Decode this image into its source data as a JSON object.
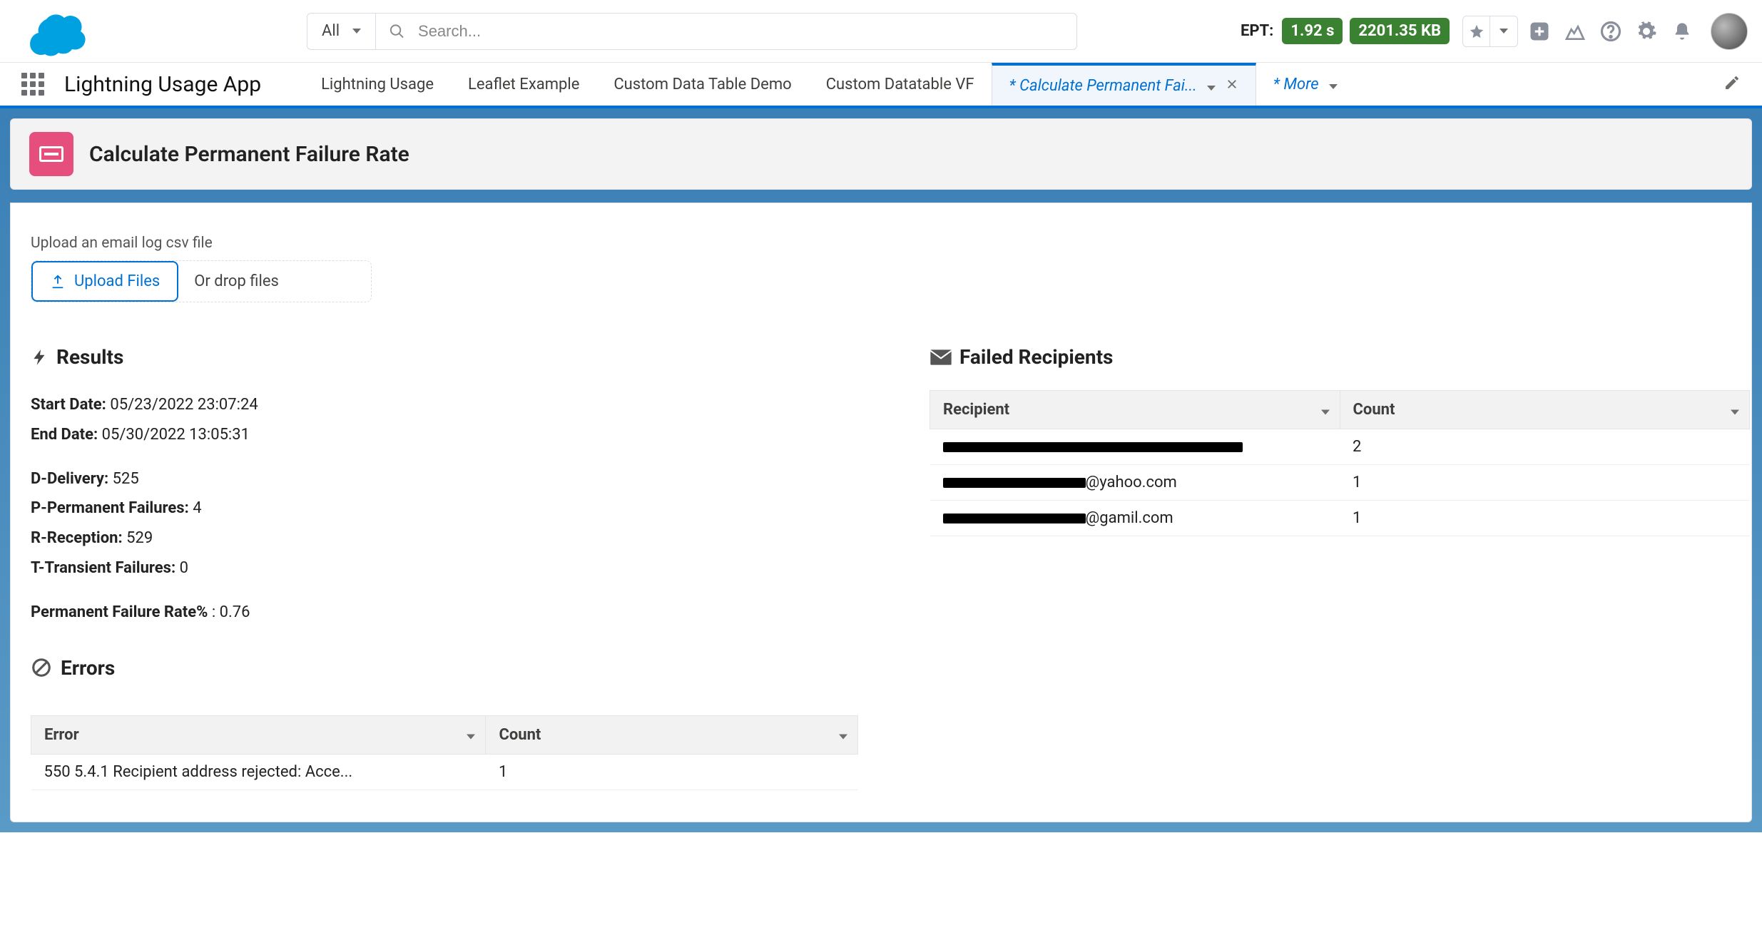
{
  "header": {
    "search_object": "All",
    "search_placeholder": "Search...",
    "ept_label": "EPT:",
    "ept_time": "1.92 s",
    "ept_size": "2201.35 KB"
  },
  "nav": {
    "app_name": "Lightning Usage App",
    "tabs": [
      {
        "label": "Lightning Usage"
      },
      {
        "label": "Leaflet Example"
      },
      {
        "label": "Custom Data Table Demo"
      },
      {
        "label": "Custom Datatable VF"
      }
    ],
    "active_tab": "* Calculate Permanent Fai...",
    "more_label": "* More"
  },
  "page": {
    "title": "Calculate Permanent Failure Rate"
  },
  "upload": {
    "label": "Upload an email log csv file",
    "button": "Upload Files",
    "drop": "Or drop files"
  },
  "results": {
    "heading": "Results",
    "start_date_label": "Start Date:",
    "start_date_value": "05/23/2022 23:07:24",
    "end_date_label": "End Date:",
    "end_date_value": "05/30/2022 13:05:31",
    "d_label": "D-Delivery:",
    "d_value": "525",
    "p_label": "P-Permanent Failures:",
    "p_value": "4",
    "r_label": "R-Reception:",
    "r_value": "529",
    "t_label": "T-Transient Failures:",
    "t_value": "0",
    "rate_label": "Permanent Failure Rate%",
    "rate_sep": " : ",
    "rate_value": "0.76"
  },
  "errors": {
    "heading": "Errors",
    "columns": {
      "error": "Error",
      "count": "Count"
    },
    "rows": [
      {
        "error": "550 5.4.1 Recipient address rejected: Acce...",
        "count": "1"
      }
    ]
  },
  "recipients": {
    "heading": "Failed Recipients",
    "columns": {
      "recipient": "Recipient",
      "count": "Count"
    },
    "rows": [
      {
        "visible_suffix": "",
        "count": "2",
        "redact_width": 420
      },
      {
        "visible_suffix": "@yahoo.com",
        "count": "1",
        "redact_width": 200
      },
      {
        "visible_suffix": "@gamil.com",
        "count": "1",
        "redact_width": 200
      }
    ]
  }
}
